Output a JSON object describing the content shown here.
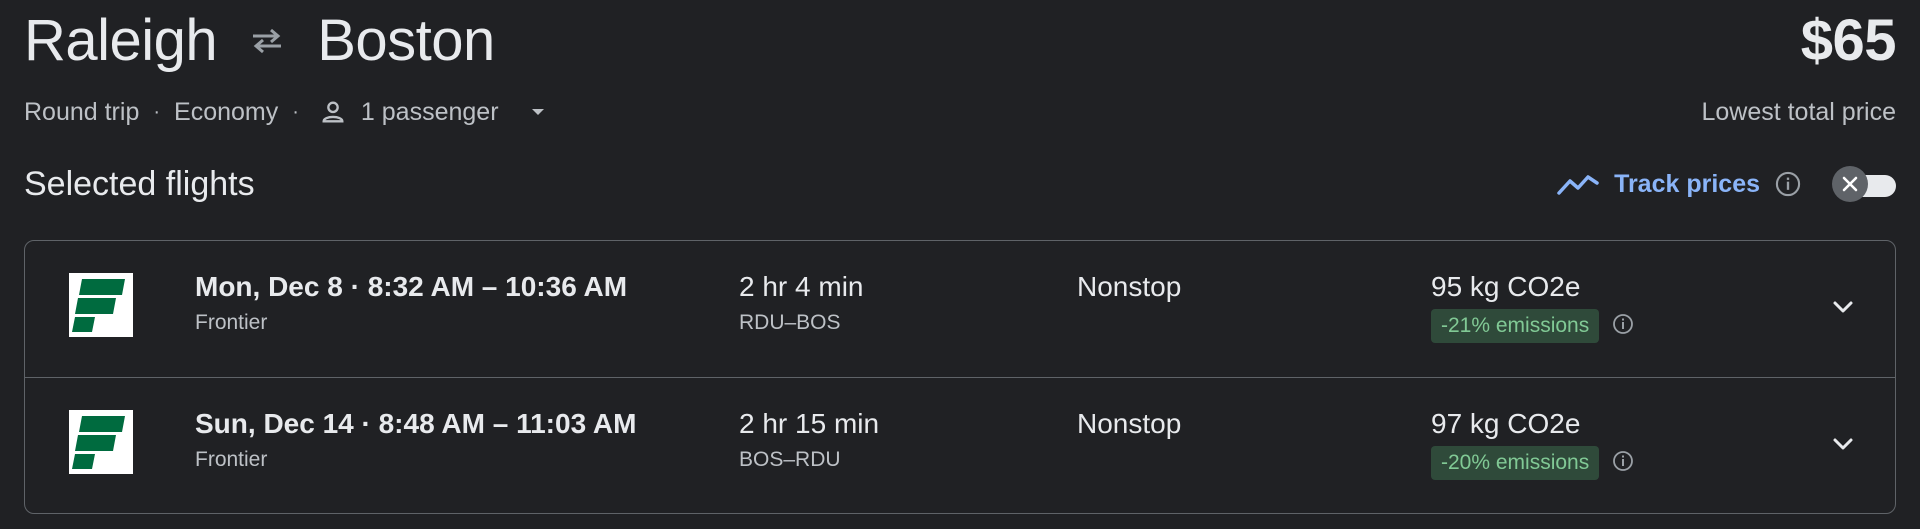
{
  "header": {
    "origin": "Raleigh",
    "destination": "Boston",
    "price": "$65",
    "price_label": "Lowest total price",
    "trip_type": "Round trip",
    "cabin": "Economy",
    "passengers": "1 passenger"
  },
  "selected": {
    "title": "Selected flights",
    "track_label": "Track prices"
  },
  "flights": [
    {
      "date_times": "Mon, Dec 8  ·  8:32 AM – 10:36 AM",
      "airline": "Frontier",
      "duration": "2 hr 4 min",
      "airports": "RDU–BOS",
      "stops": "Nonstop",
      "emissions": "95 kg CO2e",
      "emissions_badge": "-21% emissions"
    },
    {
      "date_times": "Sun, Dec 14  ·  8:48 AM – 11:03 AM",
      "airline": "Frontier",
      "duration": "2 hr 15 min",
      "airports": "BOS–RDU",
      "stops": "Nonstop",
      "emissions": "97 kg CO2e",
      "emissions_badge": "-20% emissions"
    }
  ],
  "icons": {
    "swap": "swap-arrows-icon",
    "person": "person-icon",
    "caret": "caret-down-icon",
    "trend": "trend-line-icon",
    "info": "info-icon",
    "close": "close-icon",
    "chevron": "chevron-down-icon",
    "logo": "frontier-logo"
  },
  "colors": {
    "background": "#202124",
    "accent": "#8ab4f8",
    "emissions_bg": "#2f4a3a",
    "emissions_text": "#81c995",
    "frontier_green": "#006b3f"
  }
}
